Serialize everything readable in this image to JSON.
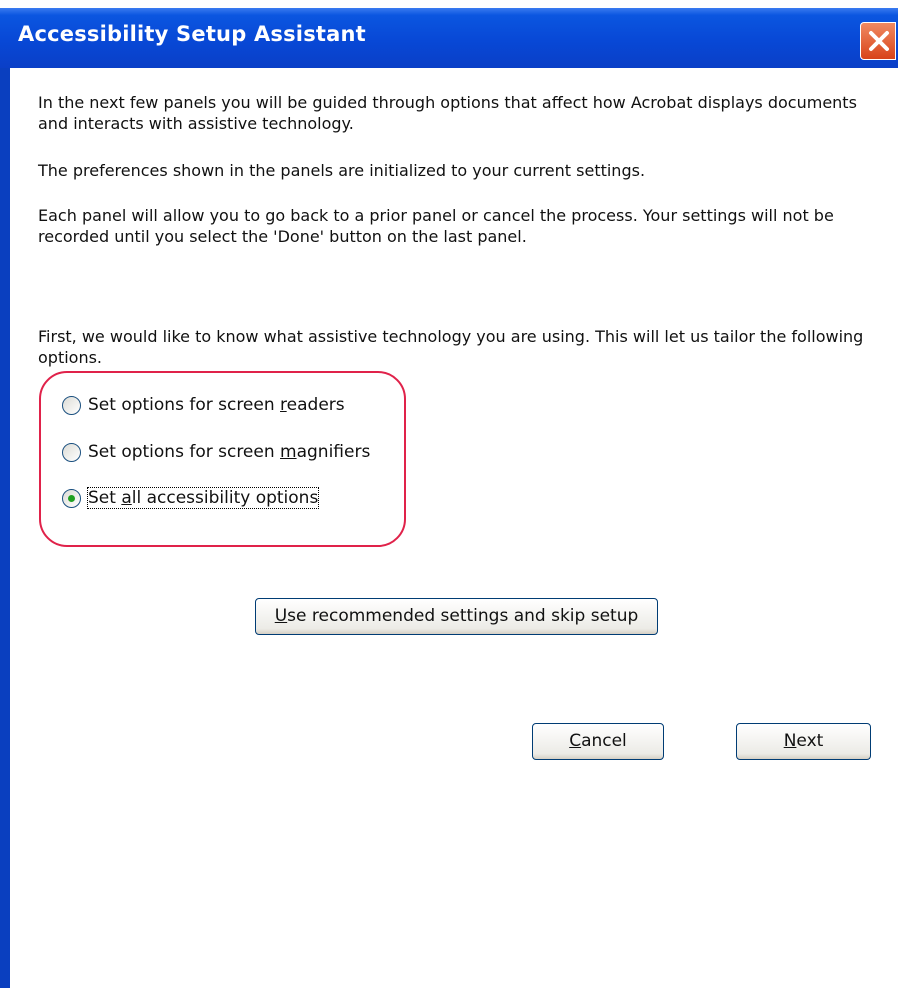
{
  "window": {
    "title": "Accessibility Setup Assistant"
  },
  "intro": {
    "paragraph1": "In the next few panels you will be guided through options that affect how Acrobat displays documents and interacts with assistive technology.",
    "paragraph2": "The preferences shown in the panels are initialized to your current settings.",
    "paragraph3": "Each panel will allow you to go back to a prior panel or cancel the process. Your settings will not be recorded until you select the 'Done' button on the last panel.",
    "question": "First, we would like to know what assistive technology you are using. This will let us tailor the following options."
  },
  "options": [
    {
      "pre": "Set options for screen ",
      "key": "r",
      "post": "eaders",
      "selected": false
    },
    {
      "pre": "Set options for screen ",
      "key": "m",
      "post": "agnifiers",
      "selected": false
    },
    {
      "pre": "Set ",
      "key": "a",
      "post": "ll accessibility options",
      "selected": true
    }
  ],
  "buttons": {
    "recommended": {
      "key": "U",
      "rest": "se recommended settings and skip setup"
    },
    "cancel": {
      "key": "C",
      "rest": "ancel"
    },
    "next": {
      "key": "N",
      "rest": "ext"
    }
  },
  "colors": {
    "titlebar": "#0848d6",
    "highlight": "#e0224a",
    "radio_selected": "#21a121"
  },
  "icons": {
    "close": "close-icon"
  }
}
